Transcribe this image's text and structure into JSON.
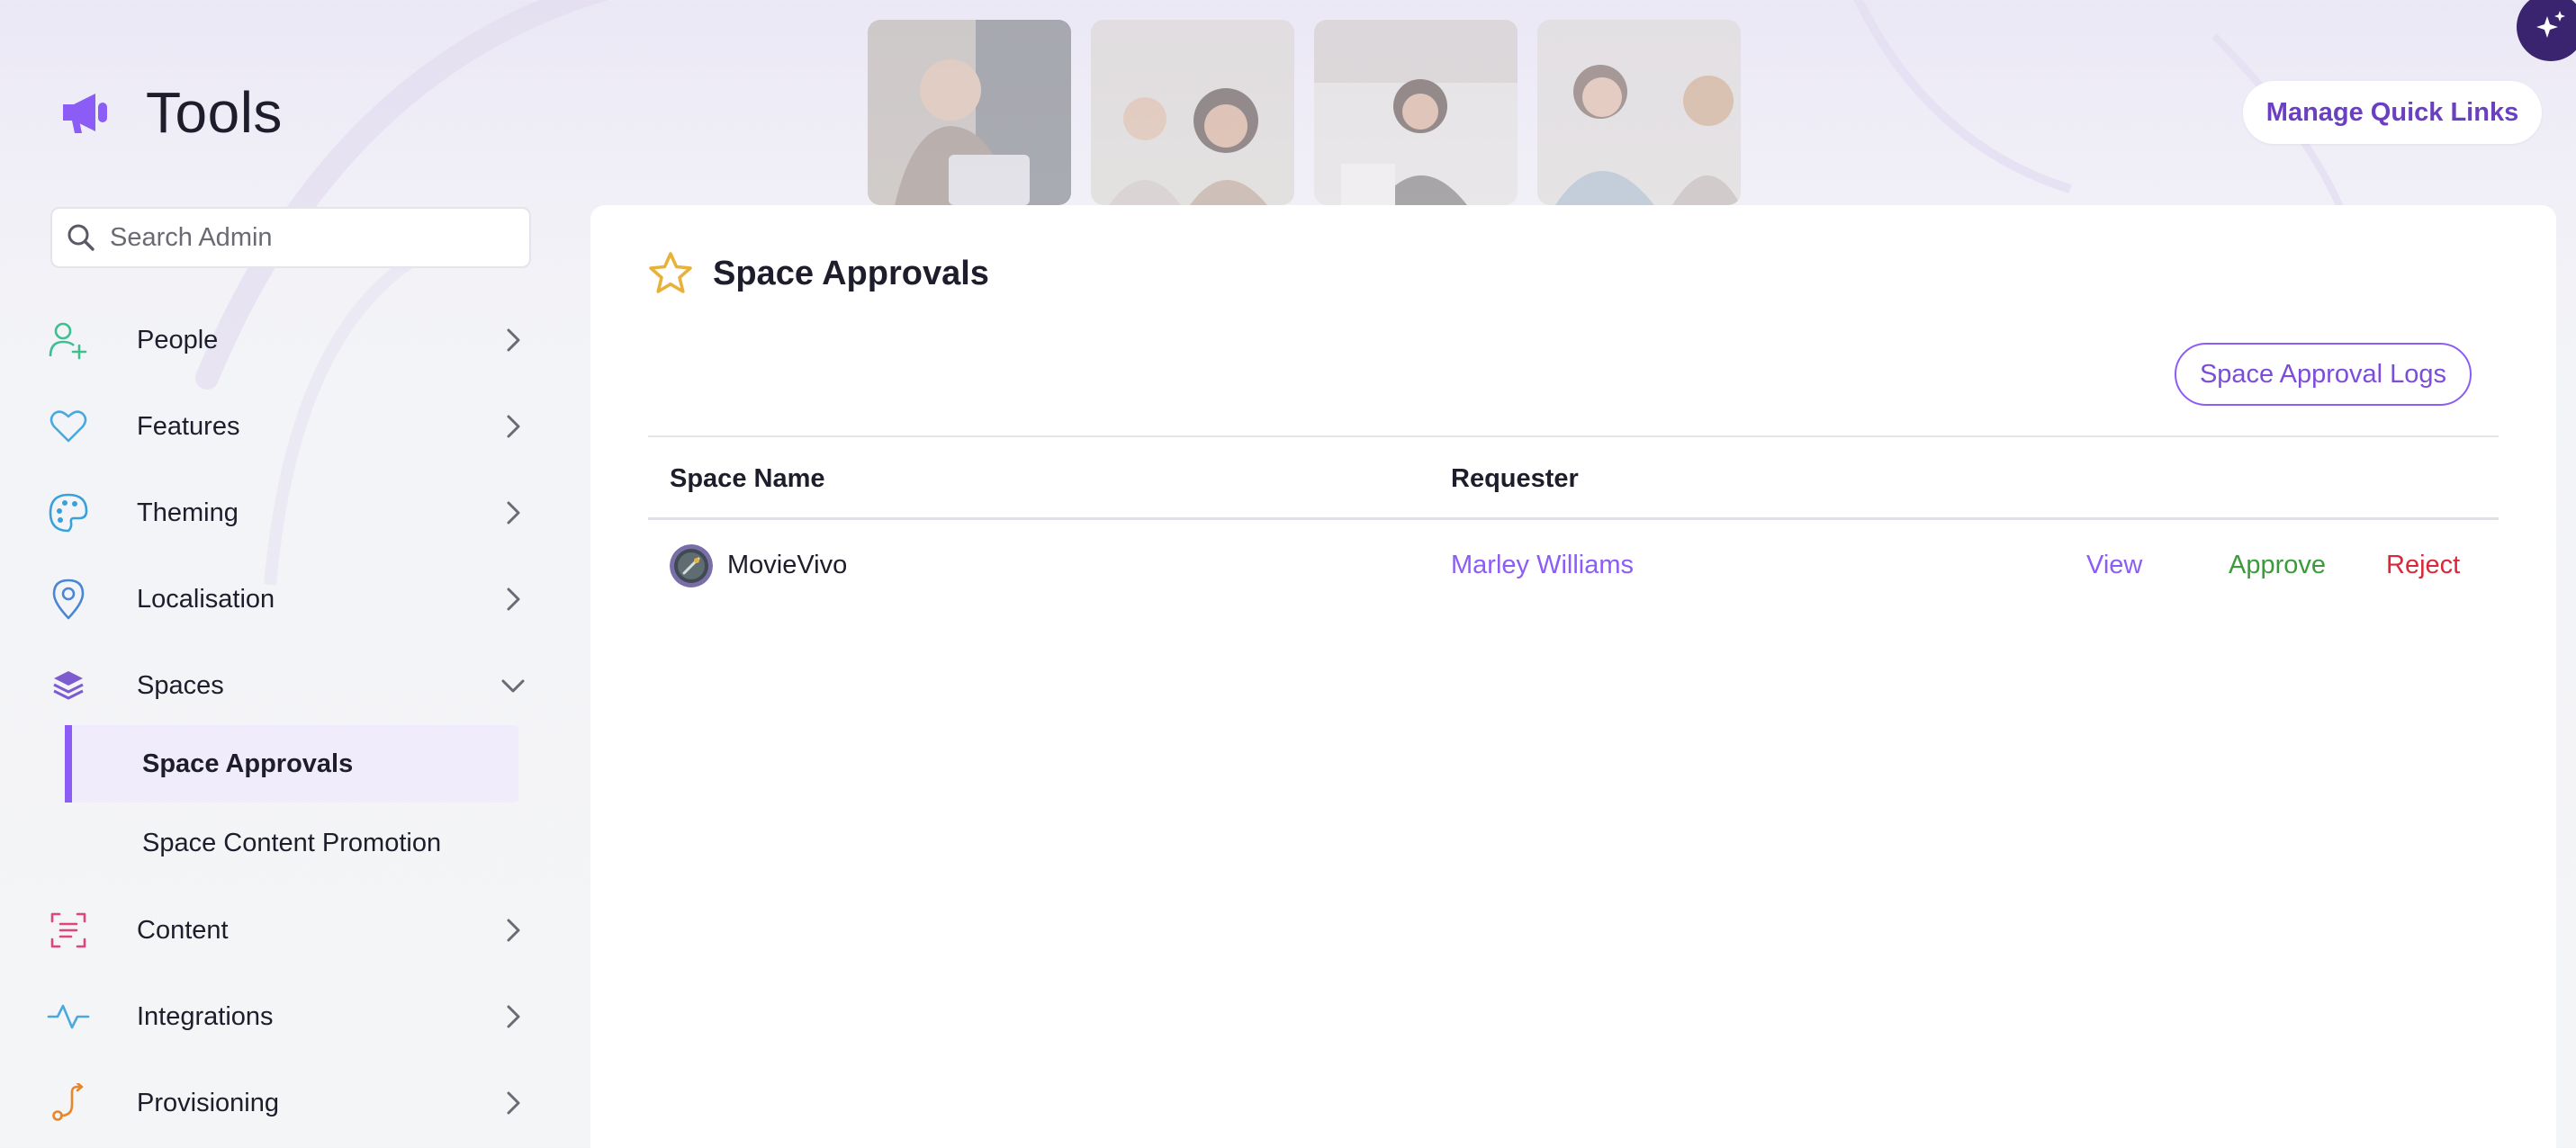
{
  "app": {
    "title": "Tools"
  },
  "header": {
    "quick_links_label": "Manage Quick Links"
  },
  "search": {
    "placeholder": "Search Admin"
  },
  "sidebar": {
    "items": [
      {
        "label": "People",
        "icon": "user-plus-icon",
        "color": "#3fbf8f"
      },
      {
        "label": "Features",
        "icon": "heart-icon",
        "color": "#4aa8e0"
      },
      {
        "label": "Theming",
        "icon": "palette-icon",
        "color": "#3aa0dc"
      },
      {
        "label": "Localisation",
        "icon": "location-pin-icon",
        "color": "#4a86d6"
      },
      {
        "label": "Spaces",
        "icon": "layers-icon",
        "color": "#7c5ccf",
        "expanded": true,
        "children": [
          {
            "label": "Space Approvals",
            "active": true
          },
          {
            "label": "Space Content Promotion",
            "active": false
          }
        ]
      },
      {
        "label": "Content",
        "icon": "scan-text-icon",
        "color": "#e0457a"
      },
      {
        "label": "Integrations",
        "icon": "activity-icon",
        "color": "#4aa8e0"
      },
      {
        "label": "Provisioning",
        "icon": "route-icon",
        "color": "#e8862d"
      }
    ]
  },
  "main": {
    "title": "Space Approvals",
    "logs_button": "Space Approval Logs",
    "table": {
      "columns": [
        "Space Name",
        "Requester"
      ],
      "rows": [
        {
          "space_name": "MovieVivo",
          "requester": "Marley Williams",
          "actions": {
            "view": "View",
            "approve": "Approve",
            "reject": "Reject"
          }
        }
      ]
    }
  },
  "colors": {
    "accent": "#8b5cf6",
    "brand_purple": "#6a3fc2",
    "approve": "#3a9b3a",
    "reject": "#d8283a",
    "star": "#e8b23a"
  }
}
